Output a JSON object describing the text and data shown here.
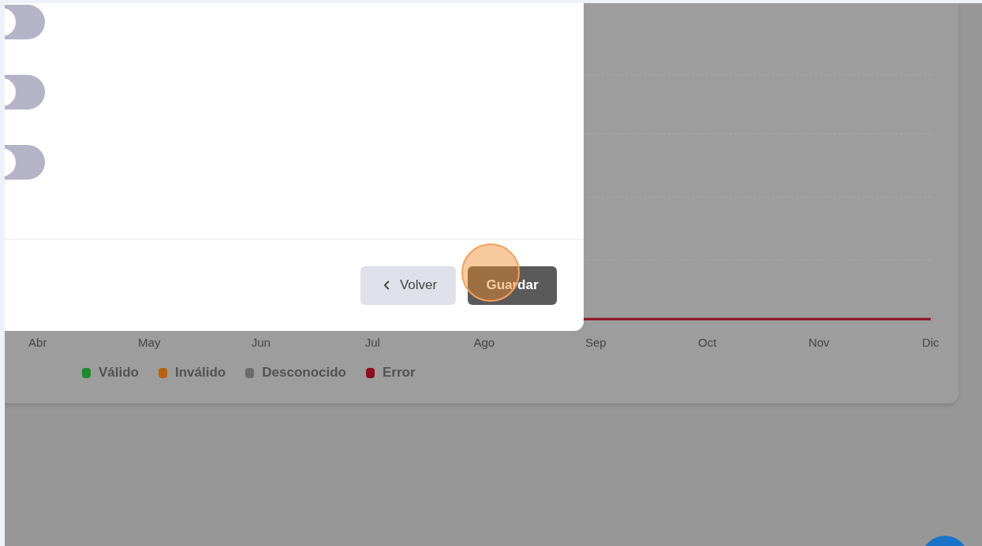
{
  "dialog": {
    "toggles": [
      {
        "on": false
      },
      {
        "on": false
      },
      {
        "on": false
      }
    ],
    "buttons": [
      {
        "label": "Volver",
        "kind": "back"
      },
      {
        "label": "Guardar",
        "kind": "primary"
      }
    ]
  },
  "chart": {
    "months": [
      "Abr",
      "May",
      "Jun",
      "Jul",
      "Ago",
      "Sep",
      "Oct",
      "Nov",
      "Dic"
    ],
    "legend": [
      {
        "label": "Válido",
        "color": "#1f8a2e"
      },
      {
        "label": "Inválido",
        "color": "#b8620f"
      },
      {
        "label": "Desconocido",
        "color": "#6b6b6b"
      },
      {
        "label": "Error",
        "color": "#8e0f1f"
      }
    ]
  }
}
